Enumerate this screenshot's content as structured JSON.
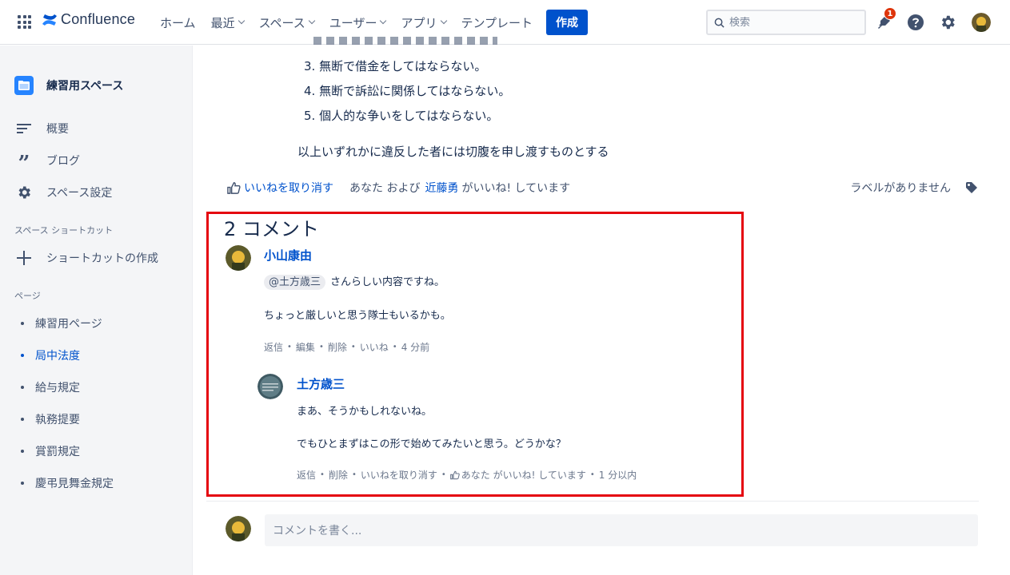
{
  "header": {
    "brand": "Confluence",
    "nav": [
      "ホーム",
      "最近",
      "スペース",
      "ユーザー",
      "アプリ",
      "テンプレート"
    ],
    "nav_caret": [
      false,
      true,
      true,
      true,
      true,
      false
    ],
    "create_label": "作成",
    "search_placeholder": "検索",
    "notification_count": "1"
  },
  "sidebar": {
    "space_name": "練習用スペース",
    "links": [
      {
        "label": "概要",
        "icon": "overview-icon"
      },
      {
        "label": "ブログ",
        "icon": "quote-icon"
      },
      {
        "label": "スペース設定",
        "icon": "gear-icon"
      }
    ],
    "shortcuts_heading": "スペース ショートカット",
    "create_shortcut": "ショートカットの作成",
    "pages_heading": "ページ",
    "pages": [
      "練習用ページ",
      "局中法度",
      "給与規定",
      "執務提要",
      "賞罰規定",
      "慶弔見舞金規定"
    ],
    "active_page": "局中法度"
  },
  "content": {
    "list_items": [
      "3. 無断で借金をしてはならない。",
      "4. 無断で訴訟に関係してはならない。",
      "5. 個人的な争いをしてはならない。"
    ],
    "paragraph": "以上いずれかに違反した者には切腹を申し渡すものとする",
    "unlike_label": "いいねを取り消す",
    "like_text_prefix": "あなた および",
    "like_user": "近藤勇",
    "like_text_suffix": "がいいね! しています",
    "no_labels": "ラベルがありません"
  },
  "comments": {
    "heading": "2 コメント",
    "items": [
      {
        "author": "小山康由",
        "mention": "@土方歳三",
        "lines": [
          "さんらしい内容ですね。",
          "ちょっと厳しいと思う隊士もいるかも。"
        ],
        "actions": [
          "返信",
          "編集",
          "削除",
          "いいね",
          "4 分前"
        ]
      },
      {
        "author": "土方歳三",
        "lines": [
          "まあ、そうかもしれないね。",
          "でもひとまずはこの形で始めてみたいと思う。どうかな？"
        ],
        "actions": [
          "返信",
          "削除",
          "いいねを取り消す",
          "あなた がいいね! しています",
          "1 分以内"
        ]
      }
    ],
    "write_placeholder": "コメントを書く..."
  },
  "colors": {
    "accent": "#0052cc",
    "highlight_box": "#e5050f",
    "badge": "#de350b"
  }
}
